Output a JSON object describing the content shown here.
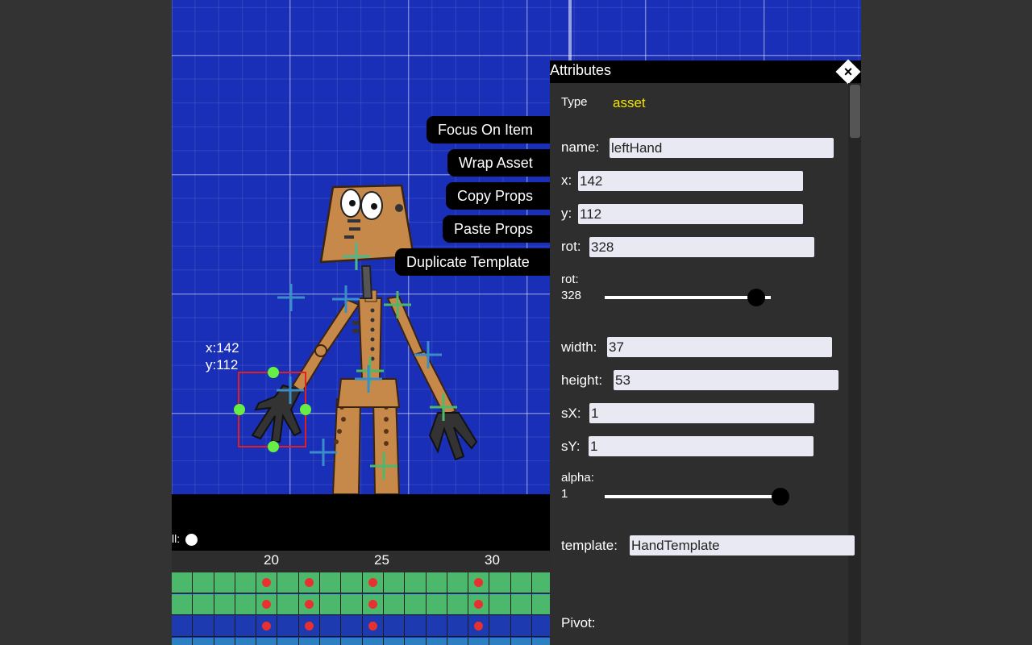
{
  "context_menu": {
    "focus_on_item": "Focus On Item",
    "wrap_asset": "Wrap Asset",
    "copy_props": "Copy Props",
    "paste_props": "Paste Props",
    "duplicate_template": "Duplicate Template"
  },
  "selection_readout": {
    "x": "x:142",
    "y": "y:112"
  },
  "timeline": {
    "all_label": "ll:",
    "ruler_numbers": [
      "20",
      "25",
      "30"
    ],
    "row_colors": [
      "#4cb86c",
      "#4cb86c",
      "#1e3ab0",
      "#2c7fc0"
    ]
  },
  "attributes": {
    "title": "Attributes",
    "close_icon": "close-icon",
    "type_label": "Type",
    "type_value": "asset",
    "type_color": "#f2e500",
    "name_label": "name:",
    "name_value": "leftHand",
    "x_label": "x:",
    "x_value": "142",
    "y_label": "y:",
    "y_value": "112",
    "rot_label": "rot:",
    "rot_value": "328",
    "rot_slider_label": "rot:",
    "rot_slider_value": "328",
    "rot_slider_fraction": 0.911,
    "width_label": "width:",
    "width_value": "37",
    "height_label": "height:",
    "height_value": "53",
    "sx_label": "sX:",
    "sx_value": "1",
    "sy_label": "sY:",
    "sy_value": "1",
    "alpha_label": "alpha:",
    "alpha_value": "1",
    "alpha_fraction": 1,
    "template_label": "template:",
    "template_value": "HandTemplate",
    "pivot_label": "Pivot:"
  },
  "colors": {
    "grid_bg": "#1a2fb8",
    "robot_body": "#c7894a",
    "selection_box": "#e02020",
    "handle": "#66ee44"
  }
}
